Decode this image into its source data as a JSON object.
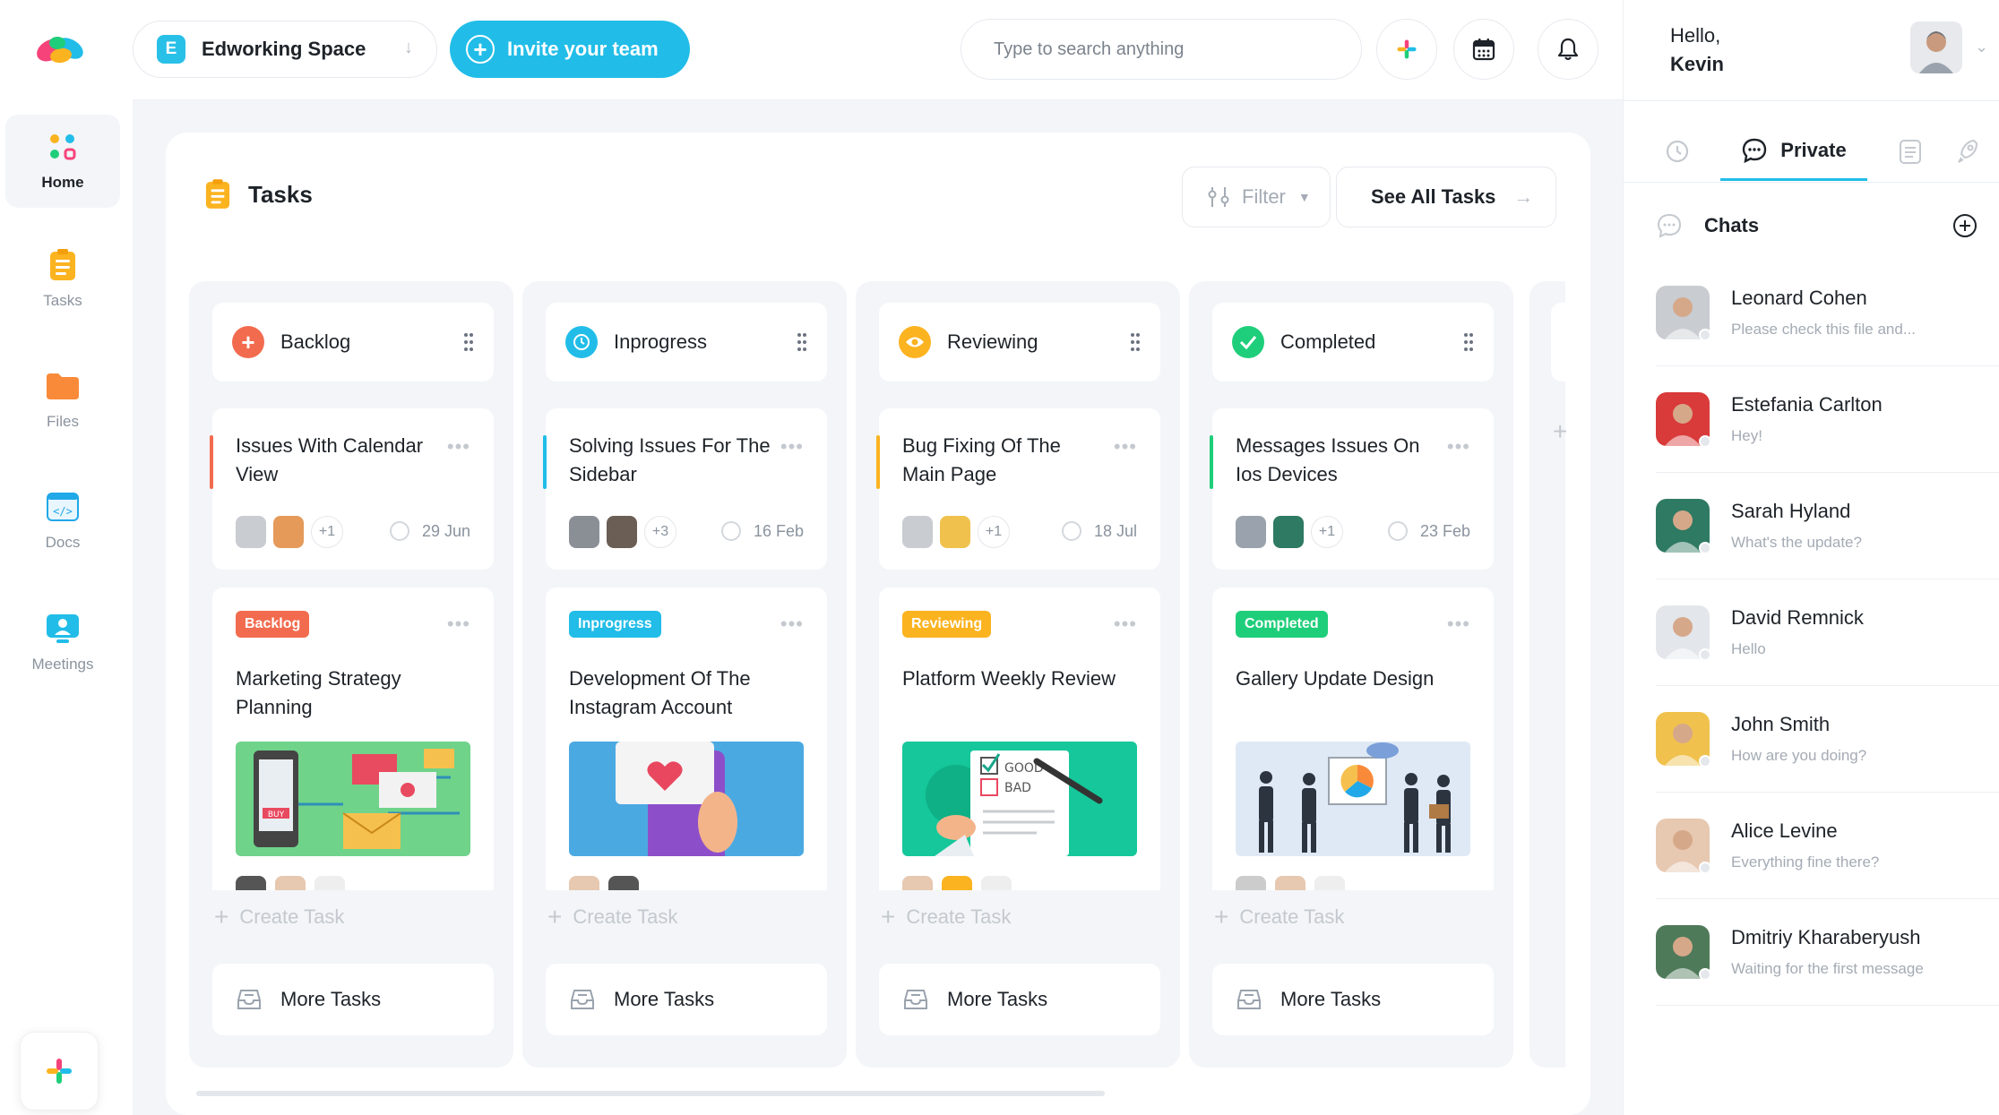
{
  "sidebar": {
    "items": [
      {
        "label": "Home",
        "icon": "home-grid-icon"
      },
      {
        "label": "Tasks",
        "icon": "tasks-icon"
      },
      {
        "label": "Files",
        "icon": "folder-icon"
      },
      {
        "label": "Docs",
        "icon": "code-doc-icon"
      },
      {
        "label": "Meetings",
        "icon": "meetings-icon"
      }
    ]
  },
  "topbar": {
    "workspace_badge": "E",
    "workspace_name": "Edworking Space",
    "invite_label": "Invite your team",
    "search_placeholder": "Type to search anything"
  },
  "user": {
    "greeting": "Hello,",
    "name": "Kevin"
  },
  "right_panel": {
    "active_tab": "Private",
    "chats_title": "Chats",
    "chats": [
      {
        "name": "Leonard Cohen",
        "message": "Please check this file and...",
        "color": "#c9ccd1"
      },
      {
        "name": "Estefania Carlton",
        "message": "Hey!",
        "color": "#d93a3a"
      },
      {
        "name": "Sarah Hyland",
        "message": "What's the update?",
        "color": "#2f7a62"
      },
      {
        "name": "David Remnick",
        "message": "Hello",
        "color": "#e3e6ea"
      },
      {
        "name": "John Smith",
        "message": "How are you doing?",
        "color": "#f0c24d"
      },
      {
        "name": "Alice Levine",
        "message": "Everything fine there?",
        "color": "#e7c8b0"
      },
      {
        "name": "Dmitriy Kharaberyush",
        "message": "Waiting for the first message",
        "color": "#4f7a5a"
      }
    ]
  },
  "board": {
    "title": "Tasks",
    "filter_label": "Filter",
    "see_all_label": "See All Tasks",
    "create_label": "Create Task",
    "more_label": "More Tasks",
    "columns": [
      {
        "name": "Backlog",
        "color": "#f26b4f",
        "card1": {
          "title": "Issues With Calendar View",
          "extra": "+1",
          "due": "29 Jun"
        },
        "card2": {
          "tag": "Backlog",
          "title": "Marketing Strategy Planning"
        }
      },
      {
        "name": "Inprogress",
        "color": "#21bde8",
        "card1": {
          "title": "Solving Issues For The Sidebar",
          "extra": "+3",
          "due": "16 Feb"
        },
        "card2": {
          "tag": "Inprogress",
          "title": "Development Of The Instagram Account"
        }
      },
      {
        "name": "Reviewing",
        "color": "#fbb320",
        "card1": {
          "title": "Bug Fixing Of The Main Page",
          "extra": "+1",
          "due": "18 Jul"
        },
        "card2": {
          "tag": "Reviewing",
          "title": "Platform Weekly Review"
        }
      },
      {
        "name": "Completed",
        "color": "#1fce7a",
        "card1": {
          "title": "Messages Issues On Ios Devices",
          "extra": "+1",
          "due": "23 Feb"
        },
        "card2": {
          "tag": "Completed",
          "title": "Gallery Update Design"
        }
      }
    ],
    "illustration_text": {
      "good": "GOOD",
      "bad": "BAD",
      "buy": "BUY"
    }
  }
}
